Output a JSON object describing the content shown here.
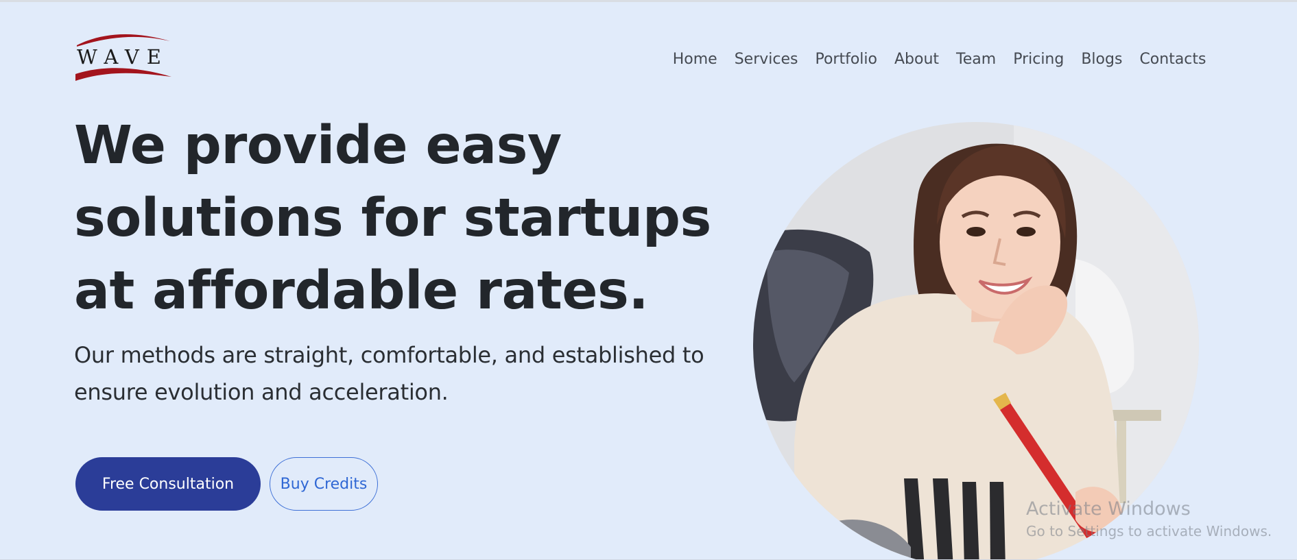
{
  "logo": {
    "text": "WAVE",
    "accent_color": "#a3141d"
  },
  "nav": {
    "items": [
      "Home",
      "Services",
      "Portfolio",
      "About",
      "Team",
      "Pricing",
      "Blogs",
      "Contacts"
    ]
  },
  "hero": {
    "headline": "We provide easy solutions for startups at affordable rates.",
    "subtext": "Our methods are straight, comfortable, and established to ensure evolution and acceleration.",
    "primary_button": "Free Consultation",
    "secondary_button": "Buy Credits",
    "image_alt_icon": "woman-portrait-image"
  },
  "watermark": {
    "title": "Activate Windows",
    "subtitle": "Go to Settings to activate Windows."
  },
  "colors": {
    "background": "#e1ebfa",
    "primary": "#2b3d98",
    "outline": "#3d6fd6",
    "text": "#22262b",
    "nav_text": "#454a52"
  }
}
